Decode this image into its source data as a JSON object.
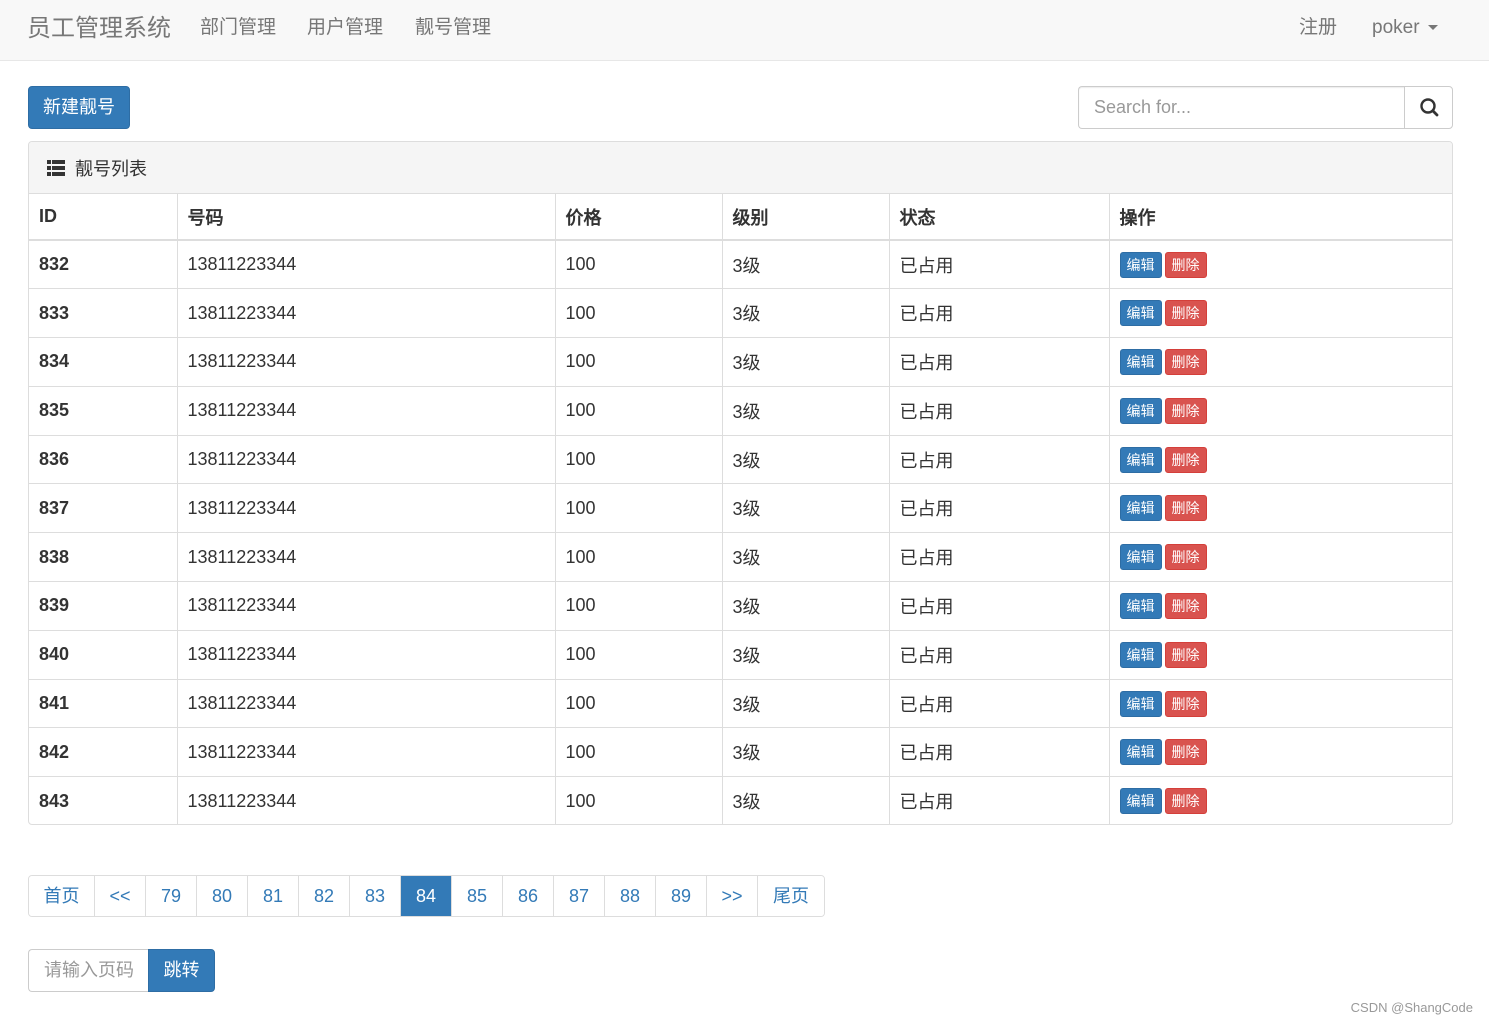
{
  "navbar": {
    "brand": "员工管理系统",
    "links": [
      "部门管理",
      "用户管理",
      "靓号管理"
    ],
    "register": "注册",
    "user": "poker"
  },
  "toolbar": {
    "new_button": "新建靓号",
    "search_placeholder": "Search for..."
  },
  "panel": {
    "title": "靓号列表",
    "icon": "list-icon",
    "columns": [
      "ID",
      "号码",
      "价格",
      "级别",
      "状态",
      "操作"
    ],
    "edit_label": "编辑",
    "delete_label": "删除",
    "rows": [
      {
        "id": "832",
        "mobile": "13811223344",
        "price": "100",
        "level": "3级",
        "status": "已占用"
      },
      {
        "id": "833",
        "mobile": "13811223344",
        "price": "100",
        "level": "3级",
        "status": "已占用"
      },
      {
        "id": "834",
        "mobile": "13811223344",
        "price": "100",
        "level": "3级",
        "status": "已占用"
      },
      {
        "id": "835",
        "mobile": "13811223344",
        "price": "100",
        "level": "3级",
        "status": "已占用"
      },
      {
        "id": "836",
        "mobile": "13811223344",
        "price": "100",
        "level": "3级",
        "status": "已占用"
      },
      {
        "id": "837",
        "mobile": "13811223344",
        "price": "100",
        "level": "3级",
        "status": "已占用"
      },
      {
        "id": "838",
        "mobile": "13811223344",
        "price": "100",
        "level": "3级",
        "status": "已占用"
      },
      {
        "id": "839",
        "mobile": "13811223344",
        "price": "100",
        "level": "3级",
        "status": "已占用"
      },
      {
        "id": "840",
        "mobile": "13811223344",
        "price": "100",
        "level": "3级",
        "status": "已占用"
      },
      {
        "id": "841",
        "mobile": "13811223344",
        "price": "100",
        "level": "3级",
        "status": "已占用"
      },
      {
        "id": "842",
        "mobile": "13811223344",
        "price": "100",
        "level": "3级",
        "status": "已占用"
      },
      {
        "id": "843",
        "mobile": "13811223344",
        "price": "100",
        "level": "3级",
        "status": "已占用"
      }
    ]
  },
  "pagination": {
    "items": [
      "首页",
      "<<",
      "79",
      "80",
      "81",
      "82",
      "83",
      "84",
      "85",
      "86",
      "87",
      "88",
      "89",
      ">>",
      "尾页"
    ],
    "active": "84",
    "jump_placeholder": "请输入页码",
    "jump_button": "跳转"
  },
  "colors": {
    "primary": "#337ab7",
    "danger": "#d9534f",
    "navbar_bg": "#f8f8f8"
  },
  "watermark": "CSDN @ShangCode"
}
